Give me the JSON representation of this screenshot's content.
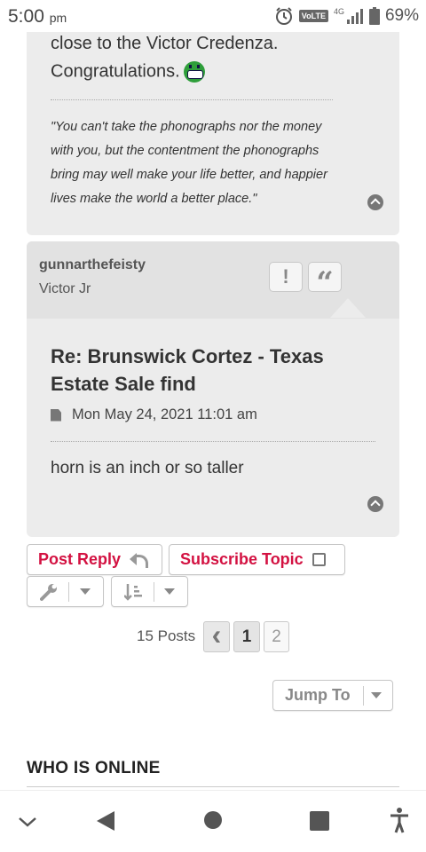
{
  "status_bar": {
    "time": "5:00",
    "ampm": "pm",
    "network": "VoLTE",
    "signal": "4G",
    "battery": "69%"
  },
  "post_prev": {
    "text_line1": "close to the Victor Credenza.",
    "text_line2": "Congratulations.",
    "signature_quote": "\"You can't take the phonographs nor the money with you, but the contentment the phonographs bring may well make your life better, and happier lives make the world a better place.\""
  },
  "post": {
    "username": "gunnarthefeisty",
    "rank": "Victor Jr",
    "report_glyph": "!",
    "quote_glyph": "“",
    "title": "Re: Brunswick Cortez - Texas Estate Sale find",
    "date": "Mon May 24, 2021 11:01 am",
    "body": "horn is an inch or so taller"
  },
  "actions": {
    "post_reply": "Post Reply",
    "subscribe": "Subscribe Topic"
  },
  "pagination": {
    "label": "15 Posts",
    "prev": "‹",
    "current": "1",
    "next_page": "2"
  },
  "jump_to": "Jump To",
  "who_is_online": "WHO IS ONLINE",
  "colors": {
    "accent_red": "#d31141",
    "panel": "#ececec",
    "panel_header": "#e2e2e2"
  }
}
